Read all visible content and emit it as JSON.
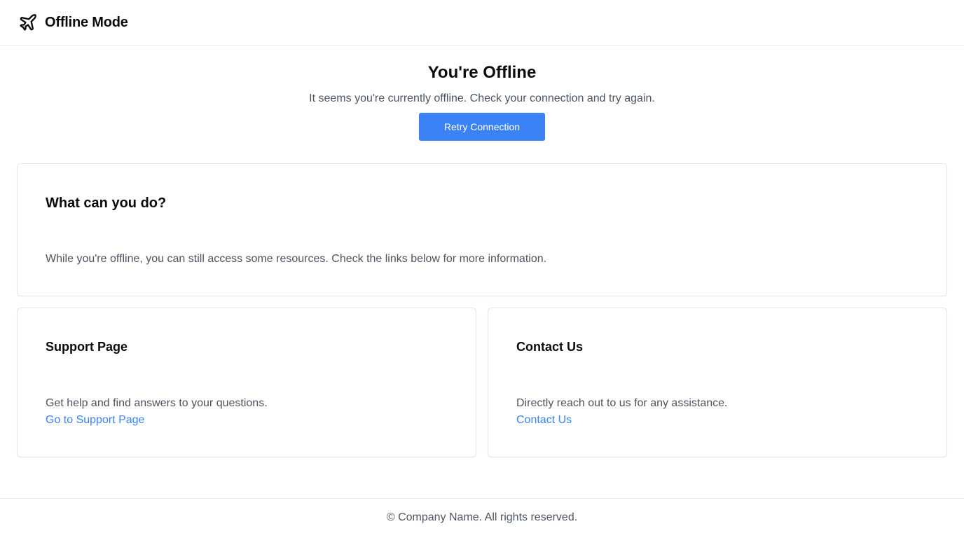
{
  "header": {
    "brand": "Offline Mode",
    "icon": "airplane-icon"
  },
  "hero": {
    "title": "You're Offline",
    "subtitle": "It seems you're currently offline. Check your connection and try again.",
    "retry_label": "Retry Connection"
  },
  "info_card": {
    "title": "What can you do?",
    "description": "While you're offline, you can still access some resources. Check the links below for more information."
  },
  "support_card": {
    "title": "Support Page",
    "description": "Get help and find answers to your questions.",
    "link_label": "Go to Support Page"
  },
  "contact_card": {
    "title": "Contact Us",
    "description": "Directly reach out to us for any assistance.",
    "link_label": "Contact Us"
  },
  "footer": {
    "text": "© Company Name. All rights reserved."
  },
  "colors": {
    "accent": "#3b82f6",
    "text_muted": "#4b5563",
    "border": "#e5e7eb"
  }
}
